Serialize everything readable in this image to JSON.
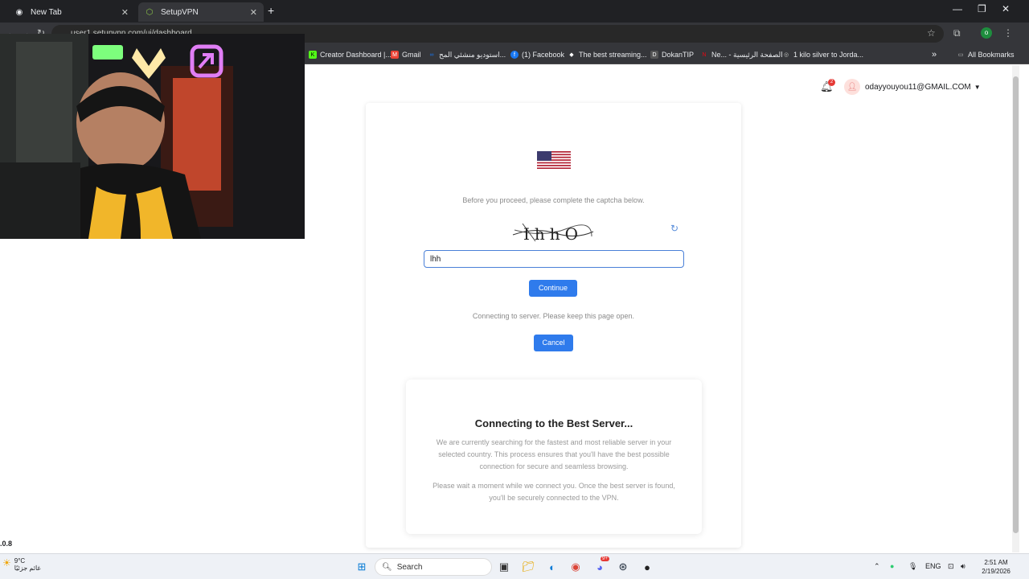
{
  "browser": {
    "tabs": [
      {
        "label": "New Tab",
        "icon": "chrome-icon"
      },
      {
        "label": "SetupVPN",
        "icon": "setupvpn-icon"
      }
    ],
    "url": "user1.setupvpn.com/ui/dashboard",
    "profile_initial": "o",
    "bookmarks": [
      {
        "label": "Creator Dashboard |...",
        "color": "#53fc18",
        "icon": "K"
      },
      {
        "label": "Gmail",
        "color": "#ea4335",
        "icon": "M"
      },
      {
        "label": "استوديو منشئي المح...",
        "color": "#1877f2",
        "icon": "∞"
      },
      {
        "label": "(1) Facebook",
        "color": "#1877f2",
        "icon": "f"
      },
      {
        "label": "The best streaming...",
        "color": "#ffffff",
        "icon": "◆"
      },
      {
        "label": "DokanTIP",
        "color": "#222222",
        "icon": "D"
      },
      {
        "label": "Ne... - الصفحة الرئيسية",
        "color": "#e50914",
        "icon": "N"
      },
      {
        "label": "1 kilo silver to Jorda...",
        "color": "#9aa0a6",
        "icon": "◎"
      }
    ],
    "all_bookmarks_label": "All Bookmarks"
  },
  "header": {
    "notification_count": "2",
    "user_email": "odayyouyou11@GMAIL.COM"
  },
  "captcha": {
    "prompt": "Before you proceed, please complete the captcha below.",
    "image_text": "IhhO",
    "input_value": "lhh",
    "continue_label": "Continue",
    "status": "Connecting to server. Please keep this page open.",
    "cancel_label": "Cancel"
  },
  "info": {
    "title": "Connecting to the Best Server...",
    "paragraph1": "We are currently searching for the fastest and most reliable server in your selected country. This process ensures that you'll have the best possible connection for secure and seamless browsing.",
    "paragraph2": "Please wait a moment while we connect you. Once the best server is found, you'll be securely connected to the VPN."
  },
  "overlay": {
    "version_text": ".0.8"
  },
  "taskbar": {
    "weather_temp": "9°C",
    "weather_desc": "غائم جزئيًا",
    "search_label": "Search",
    "discord_badge": "9+",
    "language": "ENG",
    "time": "2:51 AM",
    "date": "2/19/2026"
  }
}
